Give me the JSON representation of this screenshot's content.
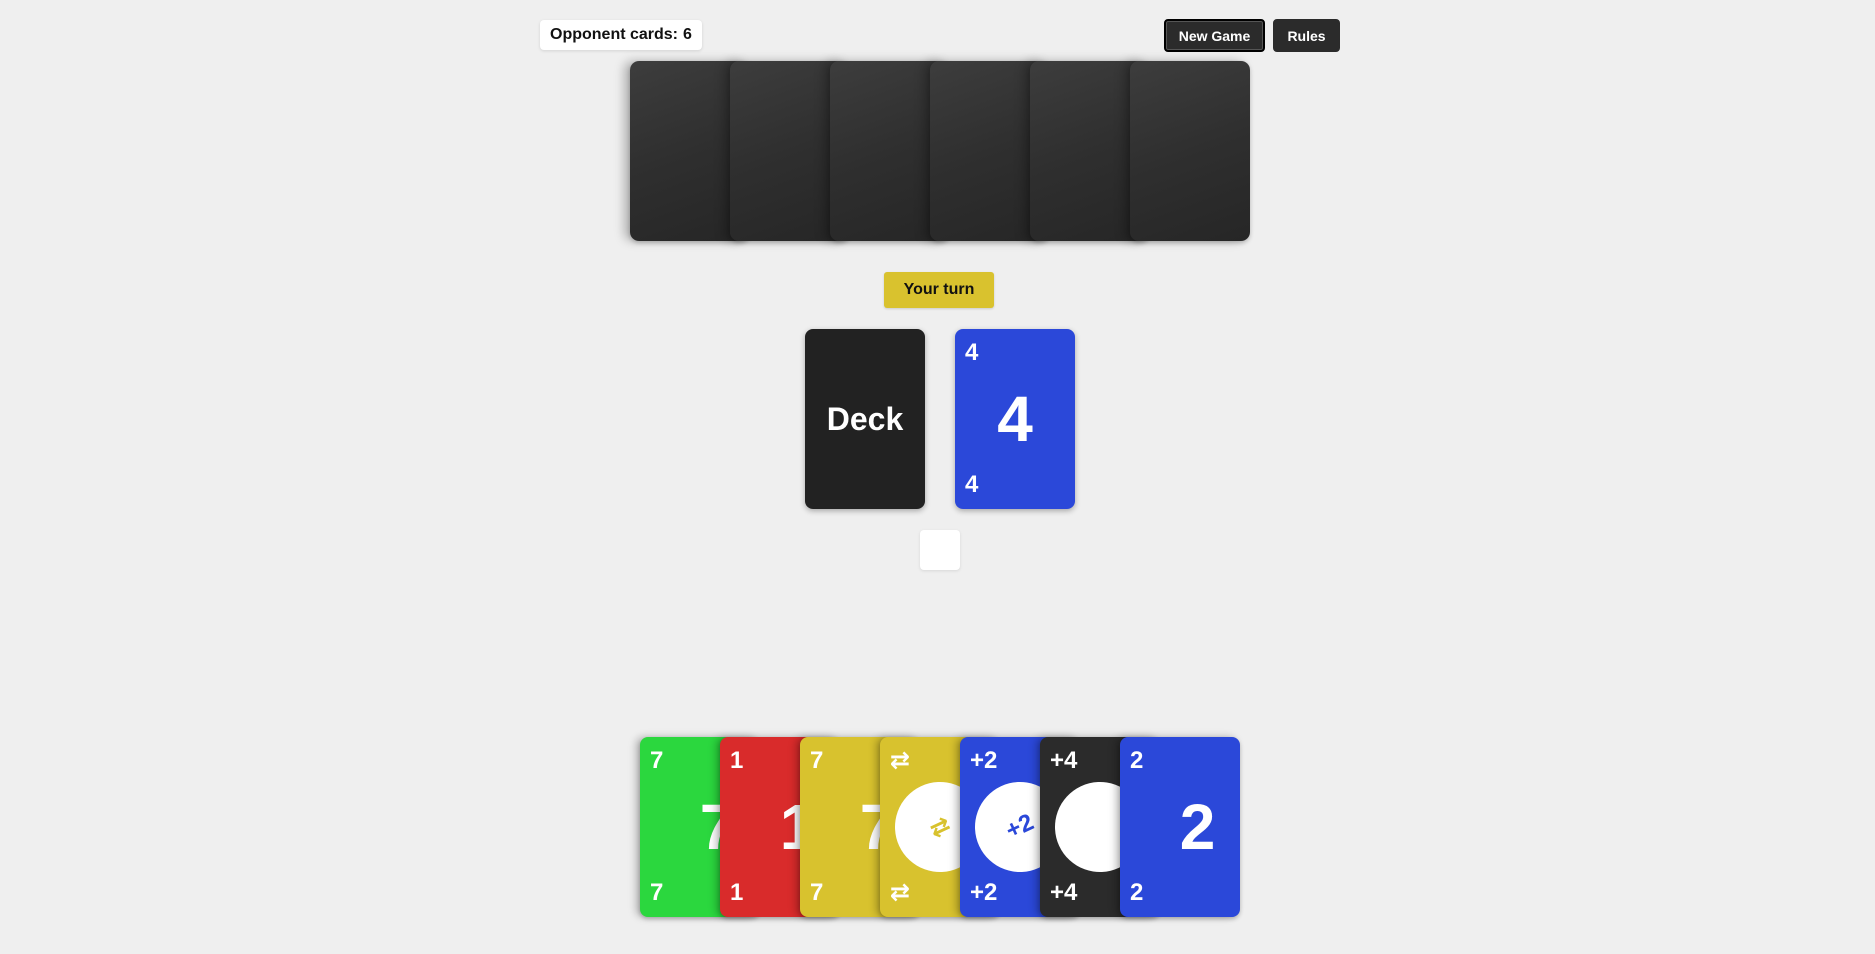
{
  "opponent": {
    "label": "Opponent cards:",
    "count": "6",
    "cards": 6
  },
  "toolbar": {
    "new_game_label": "New Game",
    "rules_label": "Rules"
  },
  "status": {
    "turn_text": "Your turn"
  },
  "deck": {
    "label": "Deck"
  },
  "discard": {
    "color": "blue",
    "corner": "4",
    "center": "4"
  },
  "colors": {
    "green": "#2bd73e",
    "red": "#d92b2b",
    "yellow": "#d8c22e",
    "blue": "#2b48d9",
    "black": "#2b2b2b",
    "deck": "#222222",
    "background": "#efefef"
  },
  "hand": [
    {
      "color": "green",
      "corner": "7",
      "center": "7",
      "kind": "number"
    },
    {
      "color": "red",
      "corner": "1",
      "center": "1",
      "kind": "number"
    },
    {
      "color": "yellow",
      "corner": "7",
      "center": "7",
      "kind": "number"
    },
    {
      "color": "yellow",
      "corner": "⇄",
      "center": "⇄",
      "kind": "reverse"
    },
    {
      "color": "blue",
      "corner": "+2",
      "center": "+2",
      "kind": "draw2"
    },
    {
      "color": "black",
      "corner": "+4",
      "center": "",
      "kind": "wild4"
    },
    {
      "color": "blue",
      "corner": "2",
      "center": "2",
      "kind": "number"
    }
  ]
}
